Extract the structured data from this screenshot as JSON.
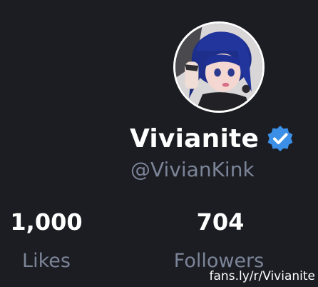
{
  "profile": {
    "display_name": "Vivianite",
    "handle": "@VivianKink",
    "verified": true,
    "accent_color": "#3b8fe6"
  },
  "stats": {
    "likes": {
      "value": "1,000",
      "label": "Likes"
    },
    "followers": {
      "value": "704",
      "label": "Followers"
    }
  },
  "watermark": "fans.ly/r/Vivianite",
  "icons": {
    "avatar": "avatar-image",
    "verified": "verified-badge-icon"
  },
  "colors": {
    "background": "#1b1d23",
    "primary_text": "#ffffff",
    "secondary_text": "#7c8497"
  }
}
